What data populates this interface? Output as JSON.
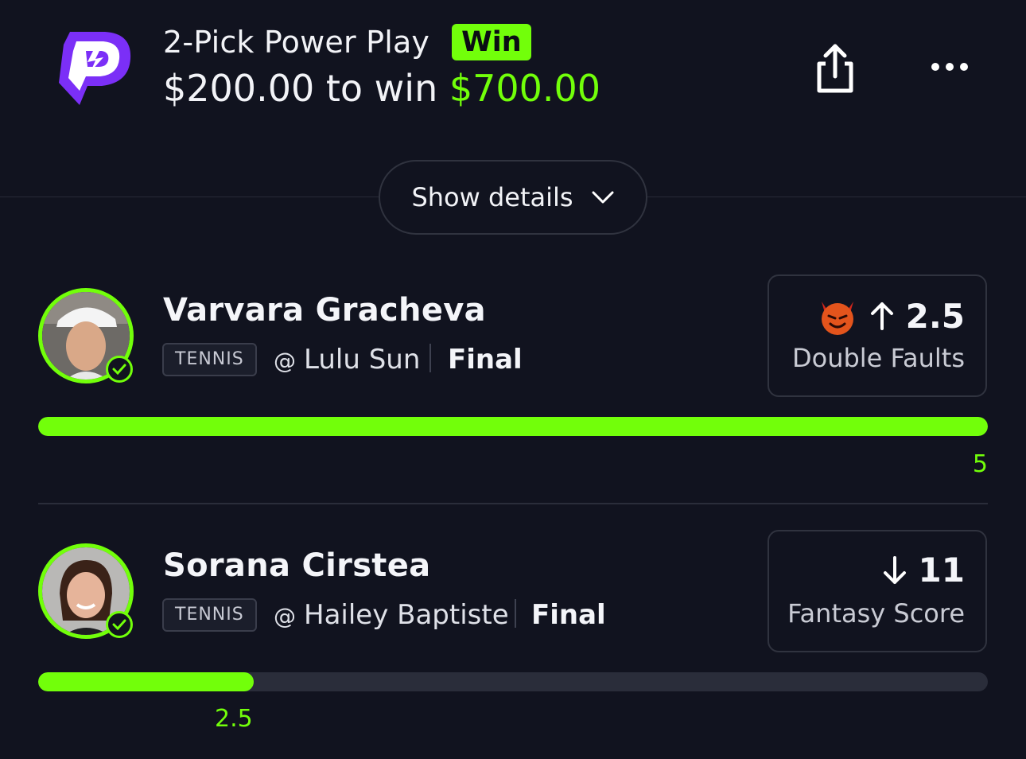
{
  "header": {
    "entry_title": "2-Pick Power Play",
    "result_badge": "Win",
    "stake": "$200.00",
    "to_win_text": "to win",
    "payout": "$700.00",
    "brand_color": "#7b2ff7",
    "accent_color": "#72ff0a"
  },
  "details_button": {
    "label": "Show details"
  },
  "picks": [
    {
      "player": "Varvara Gracheva",
      "sport": "TENNIS",
      "at_symbol": "@",
      "opponent": "Lulu Sun",
      "status": "Final",
      "line": "2.5",
      "direction_icon": "arrow-up-icon",
      "special_icon": "devil-emoji-icon",
      "stat": "Double Faults",
      "result_value": "5",
      "progress_fraction": 1.0
    },
    {
      "player": "Sorana Cirstea",
      "sport": "TENNIS",
      "at_symbol": "@",
      "opponent": "Hailey Baptiste",
      "status": "Final",
      "line": "11",
      "direction_icon": "arrow-down-icon",
      "stat": "Fantasy Score",
      "result_value": "2.5",
      "progress_fraction": 0.227
    }
  ]
}
